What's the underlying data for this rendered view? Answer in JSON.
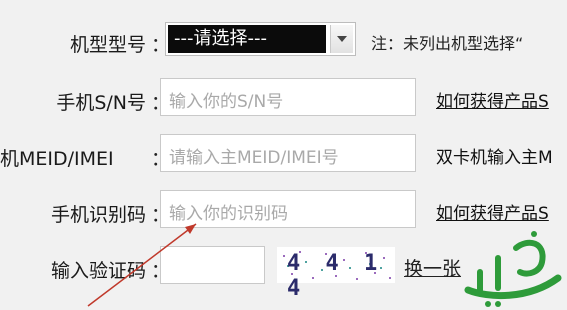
{
  "model": {
    "label": "机型型号",
    "colon": "：",
    "selected": "---请选择---",
    "note": "注：未列出机型选择“"
  },
  "sn": {
    "label": "手机S/N号",
    "colon": "：",
    "placeholder": "输入你的S/N号",
    "link": "如何获得产品S"
  },
  "meid": {
    "label": "机MEID/IMEI",
    "colon": "：",
    "placeholder": "请输入主MEID/IMEI号",
    "side_text": "双卡机输入主M"
  },
  "idcode": {
    "label": "手机识别码",
    "colon": "：",
    "placeholder": "输入你的识别码",
    "link": "如何获得产品S"
  },
  "captcha": {
    "label": "输入验证码",
    "colon": "：",
    "value": "",
    "image_text": "4 4 1 4",
    "refresh": "换一张"
  },
  "colors": {
    "background": "#f1f1f1",
    "annotation_arrow": "#c0392b",
    "watermark": "#2e9b3a"
  }
}
